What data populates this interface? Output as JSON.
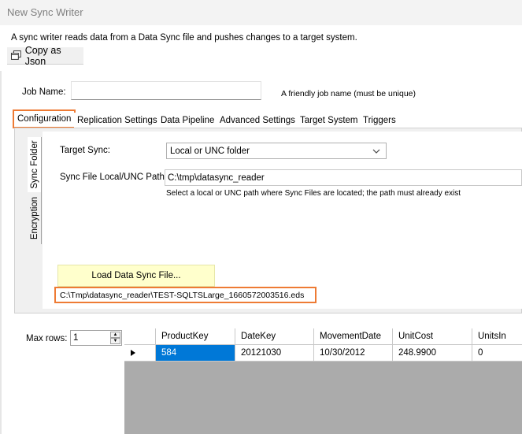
{
  "window": {
    "title": "New Sync Writer"
  },
  "description": "A sync writer reads data from a Data Sync file and pushes changes to a target system.",
  "toolbar": {
    "copy_json_label": "Copy as Json",
    "copy_icon": "copy-icon"
  },
  "job": {
    "label": "Job Name:",
    "value": "",
    "hint": "A friendly job name (must be unique)"
  },
  "tabs": [
    {
      "label": "Configuration",
      "active": true
    },
    {
      "label": "Replication Settings"
    },
    {
      "label": "Data Pipeline"
    },
    {
      "label": "Advanced Settings"
    },
    {
      "label": "Target System"
    },
    {
      "label": "Triggers"
    }
  ],
  "side_tabs": [
    {
      "label": "Sync Folder",
      "active": true
    },
    {
      "label": "Encryption"
    }
  ],
  "sync_folder": {
    "target_sync_label": "Target Sync:",
    "target_sync_value": "Local or UNC folder",
    "path_label": "Sync File Local/UNC Path:",
    "path_value": "C:\\tmp\\datasync_reader",
    "path_hint": "Select a local or UNC path where Sync Files are located; the path must already exist",
    "load_button": "Load Data Sync File...",
    "loaded_file": "C:\\Tmp\\datasync_reader\\TEST-SQLTSLarge_1660572003516.eds"
  },
  "max_rows": {
    "label": "Max rows:",
    "value": "1"
  },
  "grid": {
    "columns": [
      "ProductKey",
      "DateKey",
      "MovementDate",
      "UnitCost",
      "UnitsIn"
    ],
    "rows": [
      [
        "584",
        "20121030",
        "10/30/2012",
        "248.9900",
        "0"
      ]
    ],
    "selected_cell": [
      0,
      0
    ]
  },
  "colors": {
    "accent_highlight": "#ee7b34",
    "selection": "#0078d7",
    "load_button_bg": "#ffffcc"
  }
}
